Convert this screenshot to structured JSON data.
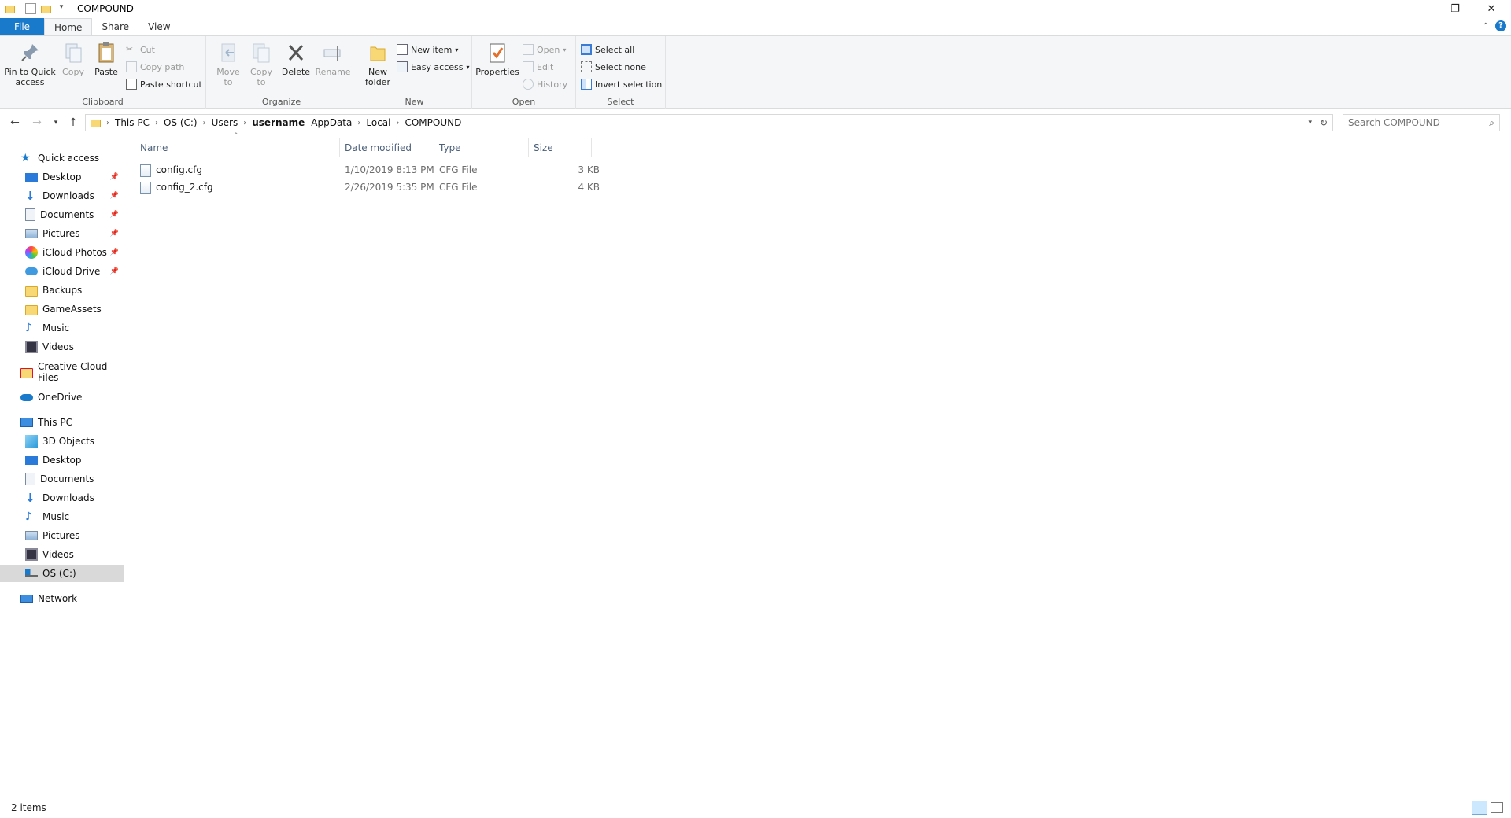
{
  "window": {
    "title": "COMPOUND",
    "minimize_glyph": "—",
    "restore_glyph": "❐",
    "close_glyph": "✕"
  },
  "ribbon_tabs": {
    "file": "File",
    "home": "Home",
    "share": "Share",
    "view": "View"
  },
  "ribbon": {
    "clipboard": {
      "label": "Clipboard",
      "pin": "Pin to Quick access",
      "copy": "Copy",
      "paste": "Paste",
      "cut": "Cut",
      "copy_path": "Copy path",
      "paste_shortcut": "Paste shortcut"
    },
    "organize": {
      "label": "Organize",
      "move_to": "Move to",
      "copy_to": "Copy to",
      "delete": "Delete",
      "rename": "Rename"
    },
    "new": {
      "label": "New",
      "new_folder": "New folder",
      "new_item": "New item",
      "easy_access": "Easy access"
    },
    "open": {
      "label": "Open",
      "properties": "Properties",
      "open": "Open",
      "edit": "Edit",
      "history": "History"
    },
    "select": {
      "label": "Select",
      "select_all": "Select all",
      "select_none": "Select none",
      "invert_selection": "Invert selection"
    }
  },
  "address": {
    "crumbs": [
      "This PC",
      "OS (C:)",
      "Users",
      "username",
      "AppData",
      "Local",
      "COMPOUND"
    ],
    "search_placeholder": "Search COMPOUND"
  },
  "nav": {
    "quick_access": "Quick access",
    "quick_items": [
      "Desktop",
      "Downloads",
      "Documents",
      "Pictures",
      "iCloud Photos",
      "iCloud Drive",
      "Backups",
      "GameAssets",
      "Music",
      "Videos"
    ],
    "creative_cloud": "Creative Cloud Files",
    "onedrive": "OneDrive",
    "this_pc": "This PC",
    "pc_items": [
      "3D Objects",
      "Desktop",
      "Documents",
      "Downloads",
      "Music",
      "Pictures",
      "Videos",
      "OS (C:)"
    ],
    "network": "Network"
  },
  "columns": {
    "name": "Name",
    "date": "Date modified",
    "type": "Type",
    "size": "Size"
  },
  "files": [
    {
      "name": "config.cfg",
      "date": "1/10/2019 8:13 PM",
      "type": "CFG File",
      "size": "3 KB"
    },
    {
      "name": "config_2.cfg",
      "date": "2/26/2019 5:35 PM",
      "type": "CFG File",
      "size": "4 KB"
    }
  ],
  "status": {
    "count": "2 items"
  }
}
